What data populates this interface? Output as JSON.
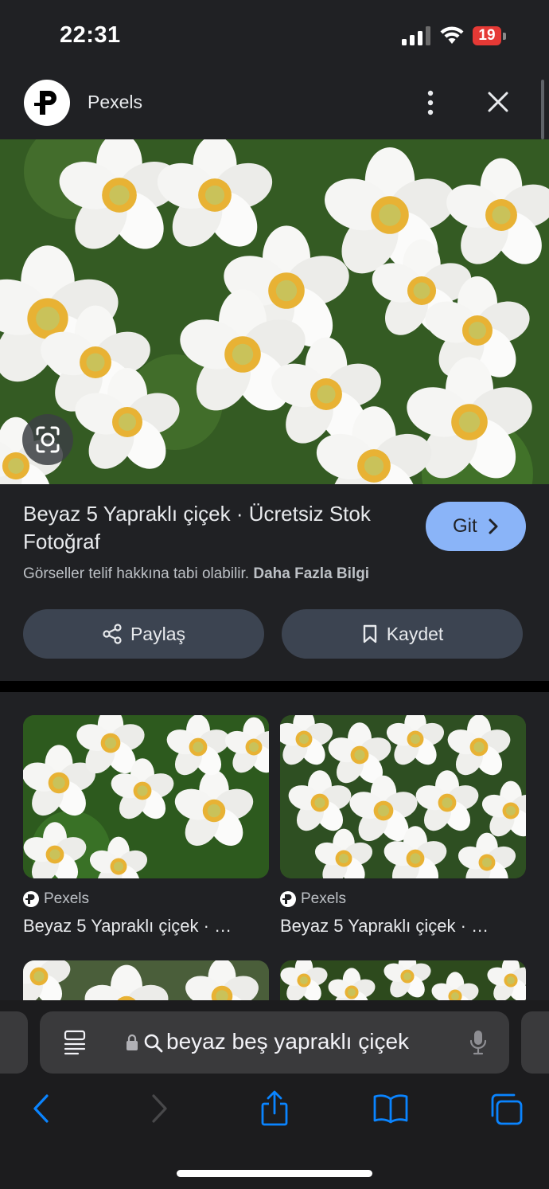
{
  "status_bar": {
    "time": "22:31",
    "battery": "19",
    "battery_color": "#e53935"
  },
  "header": {
    "site_name": "Pexels",
    "more_icon": "more-vertical-icon",
    "close_icon": "close-icon"
  },
  "result": {
    "title": "Beyaz 5 Yapraklı çiçek · Ücretsiz Stok Fotoğraf",
    "go_label": "Git",
    "copyright_text": "Görseller telif hakkına tabi olabilir.",
    "learn_more": "Daha Fazla Bilgi",
    "share_label": "Paylaş",
    "save_label": "Kaydet",
    "accent_color": "#8ab4f8"
  },
  "related": [
    {
      "source": "Pexels",
      "caption": "Beyaz 5 Yapraklı çiçek · …"
    },
    {
      "source": "Pexels",
      "caption": "Beyaz 5 Yapraklı çiçek · …"
    }
  ],
  "browser": {
    "address_text": "beyaz beş yapraklı çiçek",
    "icons": [
      "reader-icon",
      "lock-icon",
      "search-icon",
      "mic-icon",
      "back-icon",
      "forward-icon",
      "share-icon",
      "bookmarks-icon",
      "tabs-icon"
    ],
    "tint_color": "#0a84ff"
  }
}
